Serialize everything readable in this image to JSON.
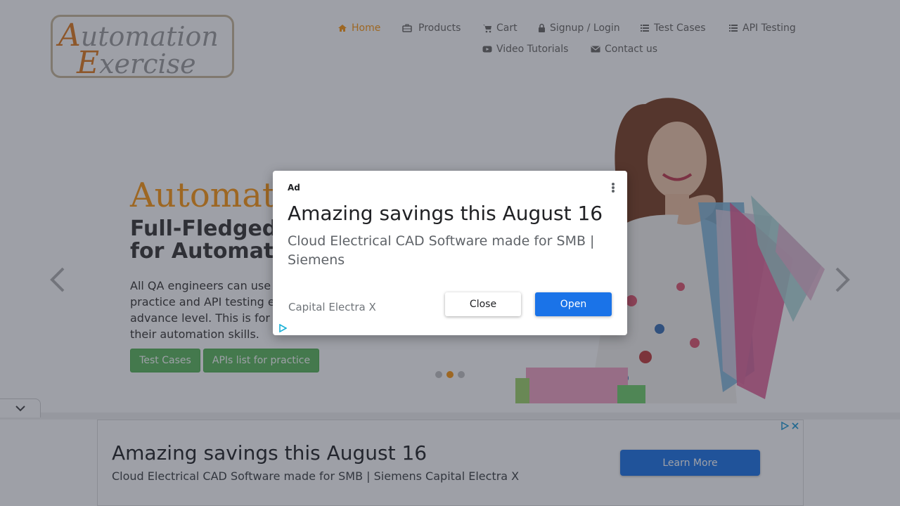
{
  "logo": {
    "line1_cap": "A",
    "line1_rest": "utomation",
    "line2_cap": "E",
    "line2_rest": "xercise"
  },
  "nav": {
    "items": [
      {
        "label": "Home",
        "icon": "home-icon"
      },
      {
        "label": "Products",
        "icon": "briefcase-icon"
      },
      {
        "label": "Cart",
        "icon": "cart-icon"
      },
      {
        "label": "Signup / Login",
        "icon": "lock-icon"
      },
      {
        "label": "Test Cases",
        "icon": "list-icon"
      },
      {
        "label": "API Testing",
        "icon": "list-icon"
      },
      {
        "label": "Video Tutorials",
        "icon": "youtube-icon"
      },
      {
        "label": "Contact us",
        "icon": "envelope-icon"
      }
    ],
    "active_color": "#fe980f"
  },
  "hero": {
    "title": "Automat",
    "subtitle": "Full-Fledged \nfor Automatio",
    "text": "All QA engineers can use \npractice and API testing e\nadvance level. This is for \ntheir automation skills.",
    "buttons": [
      "Test Cases",
      "APIs list for practice"
    ],
    "slide_count": 3,
    "active_slide": 2
  },
  "modal_ad": {
    "ad_label": "Ad",
    "title": "Amazing savings this August 16",
    "description": "Cloud Electrical CAD Software made for SMB | Siemens",
    "advertiser": "Capital Electra X",
    "close_label": "Close",
    "open_label": "Open"
  },
  "bottom_ad": {
    "title": "Amazing savings this August 16",
    "description": "Cloud Electrical CAD Software made for SMB | Siemens Capital Electra X",
    "cta": "Learn More"
  },
  "colors": {
    "accent": "#fe980f",
    "button_green": "#5cb85c",
    "ad_blue": "#1a73e8"
  }
}
